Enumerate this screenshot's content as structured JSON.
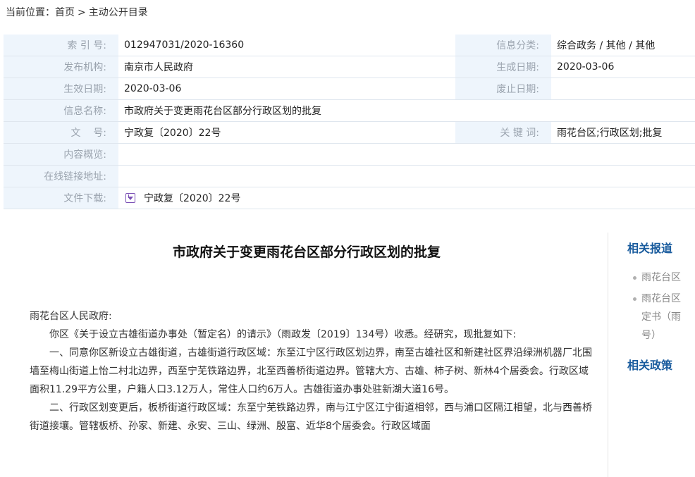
{
  "breadcrumb": {
    "prefix": "当前位置：",
    "home": "首页",
    "separator": ">",
    "current": "主动公开目录"
  },
  "meta": {
    "index_label": "索 引 号:",
    "index_value": "012947031/2020-16360",
    "category_label": "信息分类:",
    "category_value": "综合政务 / 其他 / 其他",
    "publisher_label": "发布机构:",
    "publisher_value": "南京市人民政府",
    "created_label": "生成日期:",
    "created_value": "2020-03-06",
    "effective_label": "生效日期:",
    "effective_value": "2020-03-06",
    "expire_label": "废止日期:",
    "expire_value": "",
    "name_label": "信息名称:",
    "name_value": "市政府关于变更雨花台区部分行政区划的批复",
    "docno_label": "文    号:",
    "docno_value": "宁政复〔2020〕22号",
    "keywords_label": "关 键 词:",
    "keywords_value": "雨花台区;行政区划;批复",
    "summary_label": "内容概览:",
    "summary_value": "",
    "link_label": "在线链接地址:",
    "link_value": "",
    "download_label": "文件下载:",
    "download_value": "宁政复〔2020〕22号",
    "download_icon": "download-icon"
  },
  "article": {
    "title": "市政府关于变更雨花台区部分行政区划的批复",
    "addressee": "雨花台区人民政府:",
    "p1": "你区《关于设立古雄街道办事处（暂定名）的请示》（雨政发〔2019〕134号）收悉。经研究，现批复如下:",
    "p2": "一、同意你区新设立古雄街道，古雄街道行政区域：东至江宁区行政区划边界，南至古雄社区和新建社区界沿绿洲机器厂北围墙至梅山街道上怡二村北边界，西至宁芜铁路边界，北至西善桥街道边界。管辖大方、古雄、柿子树、新林4个居委会。行政区域面积11.29平方公里，户籍人口3.12万人，常住人口约6万人。古雄街道办事处驻新湖大道16号。",
    "p3": "二、行政区划变更后，板桥街道行政区域：东至宁芜铁路边界，南与江宁区江宁街道相邻，西与浦口区隔江相望，北与西善桥街道接壤。管辖板桥、孙家、新建、永安、三山、绿洲、殷富、近华8个居委会。行政区域面"
  },
  "sidebar": {
    "related_reports_title": "相关报道",
    "related_items": [
      "雨花台区",
      "雨花台区定书（雨号）"
    ],
    "related_item_1": "雨花台区",
    "related_item_2_line1": "雨花台区",
    "related_item_2_line2": "定书（雨",
    "related_item_2_line3": "号）",
    "related_policies_title": "相关政策"
  },
  "colors": {
    "label_bg": "#eef5fc",
    "label_text": "#9aa3ae",
    "sidebar_heading": "#1a5c9e",
    "icon_purple": "#7a4fb5"
  }
}
